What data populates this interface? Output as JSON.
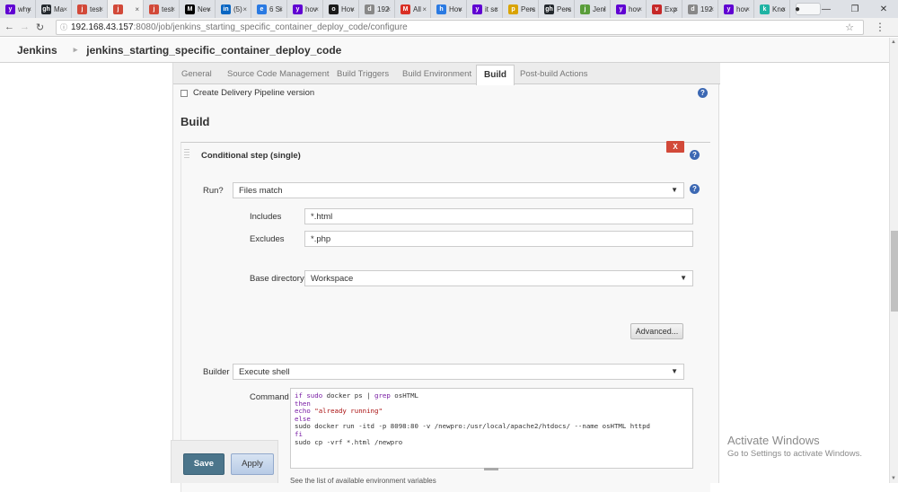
{
  "browser": {
    "tabs": [
      {
        "title": "why",
        "fav": "y",
        "color": "#6001d2"
      },
      {
        "title": "Ma",
        "fav": "gh",
        "color": "#24292e"
      },
      {
        "title": "test",
        "fav": "j",
        "color": "#d24939"
      },
      {
        "title": "",
        "fav": "j",
        "color": "#d24939",
        "active": true
      },
      {
        "title": "test",
        "fav": "j",
        "color": "#d24939"
      },
      {
        "title": "Nev",
        "fav": "M",
        "color": "#000000"
      },
      {
        "title": "(5)",
        "fav": "in",
        "color": "#0a66c2"
      },
      {
        "title": "6 Si",
        "fav": "e",
        "color": "#2a7ae2"
      },
      {
        "title": "hov",
        "fav": "y",
        "color": "#6001d2"
      },
      {
        "title": "Hov",
        "fav": "o",
        "color": "#1b1b1b"
      },
      {
        "title": "192",
        "fav": "d",
        "color": "#888888"
      },
      {
        "title": "All",
        "fav": "M",
        "color": "#d93025"
      },
      {
        "title": "Hov",
        "fav": "h",
        "color": "#2a7ae2"
      },
      {
        "title": "it sc",
        "fav": "y",
        "color": "#6001d2"
      },
      {
        "title": "Pers",
        "fav": "p",
        "color": "#d9a300"
      },
      {
        "title": "Pers",
        "fav": "gh",
        "color": "#24292e"
      },
      {
        "title": "Jenl",
        "fav": "j",
        "color": "#5a9d3a"
      },
      {
        "title": "hov",
        "fav": "y",
        "color": "#6001d2"
      },
      {
        "title": "Exp",
        "fav": "v",
        "color": "#c62828"
      },
      {
        "title": "192",
        "fav": "d",
        "color": "#888888"
      },
      {
        "title": "hov",
        "fav": "y",
        "color": "#6001d2"
      },
      {
        "title": "Kno",
        "fav": "k",
        "color": "#1fb3a3"
      }
    ],
    "url_host": "192.168.43.157",
    "url_path": ":8080/job/jenkins_starting_specific_container_deploy_code/configure"
  },
  "breadcrumbs": {
    "root": "Jenkins",
    "job": "jenkins_starting_specific_container_deploy_code"
  },
  "config_tabs": [
    "General",
    "Source Code Management",
    "Build Triggers",
    "Build Environment",
    "Build",
    "Post-build Actions"
  ],
  "active_tab": "Build",
  "delivery_pipeline_label": "Create Delivery Pipeline version",
  "section_title": "Build",
  "step": {
    "title": "Conditional step (single)",
    "delete_label": "X",
    "run_label": "Run?",
    "run_value": "Files match",
    "includes_label": "Includes",
    "includes_value": "*.html",
    "excludes_label": "Excludes",
    "excludes_value": "*.php",
    "base_dir_label": "Base directory",
    "base_dir_value": "Workspace",
    "advanced_label": "Advanced...",
    "builder_label": "Builder",
    "builder_value": "Execute shell",
    "command_label": "Command",
    "command_lines": [
      "if sudo docker ps | grep osHTML",
      "then",
      "echo \"already running\"",
      "else",
      "sudo docker run -itd -p 8098:80 -v /newpro:/usr/local/apache2/htdocs/ --name osHTML httpd",
      "fi",
      "sudo cp -vrf *.html /newpro"
    ],
    "env_link": "See the list of available environment variables"
  },
  "buttons": {
    "save": "Save",
    "apply": "Apply"
  },
  "watermark": {
    "line1": "Activate Windows",
    "line2": "Go to Settings to activate Windows."
  }
}
